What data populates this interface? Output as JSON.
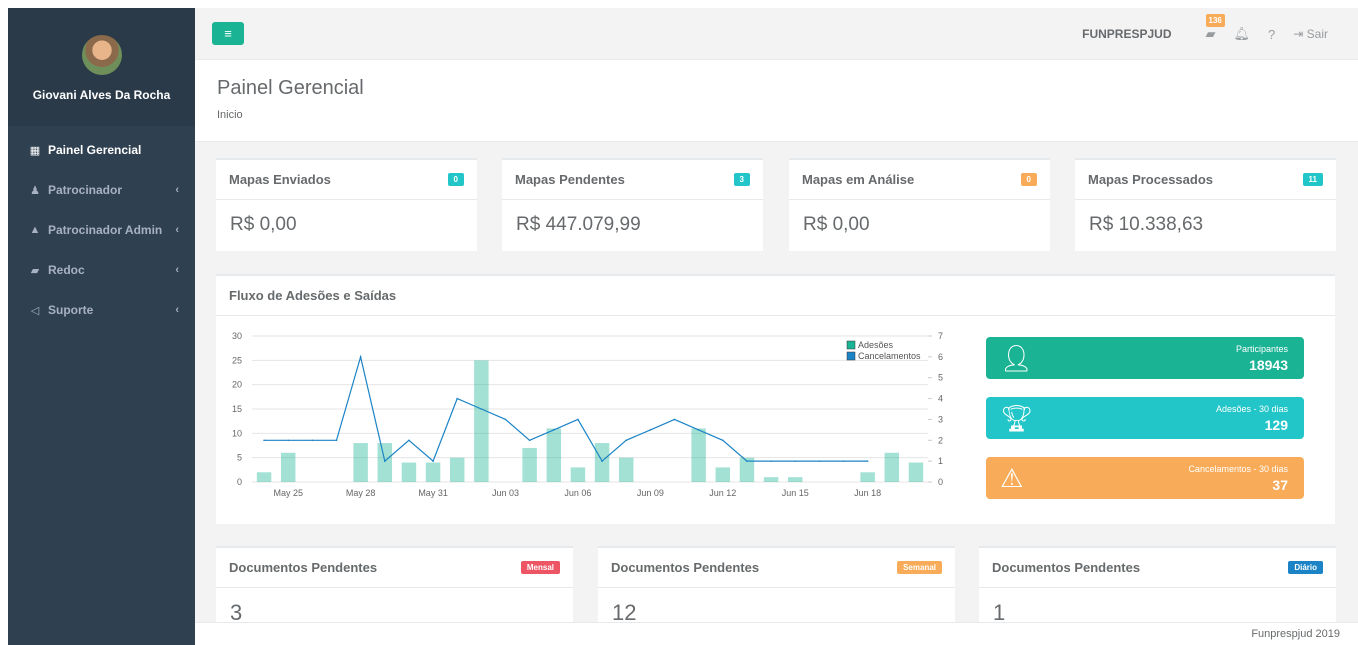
{
  "sidebar": {
    "user_name": "Giovani Alves Da Rocha",
    "items": [
      {
        "label": "Painel Gerencial",
        "icon": "th-large-icon",
        "active": true,
        "arrow": ""
      },
      {
        "label": "Patrocinador",
        "icon": "male-icon",
        "active": false,
        "arrow": "‹"
      },
      {
        "label": "Patrocinador Admin",
        "icon": "graduation-cap-icon",
        "active": false,
        "arrow": "‹"
      },
      {
        "label": "Redoc",
        "icon": "book-icon",
        "active": false,
        "arrow": "‹"
      },
      {
        "label": "Suporte",
        "icon": "bullhorn-icon",
        "active": false,
        "arrow": "‹"
      }
    ]
  },
  "topbar": {
    "org_name": "FUNPRESPJUD",
    "doc_badge": "136",
    "logout_label": "Sair"
  },
  "heading": {
    "title": "Painel Gerencial",
    "breadcrumb": "Inicio"
  },
  "stats": [
    {
      "title": "Mapas Enviados",
      "badge": "0",
      "badge_color": "#23c6c8",
      "value": "R$ 0,00"
    },
    {
      "title": "Mapas Pendentes",
      "badge": "3",
      "badge_color": "#23c6c8",
      "value": "R$ 447.079,99"
    },
    {
      "title": "Mapas em Análise",
      "badge": "0",
      "badge_color": "#f8ac59",
      "value": "R$ 0,00"
    },
    {
      "title": "Mapas Processados",
      "badge": "11",
      "badge_color": "#23c6c8",
      "value": "R$ 10.338,63"
    }
  ],
  "chart_box": {
    "title": "Fluxo de Adesões e Saídas"
  },
  "chart_data": {
    "type": "bar",
    "x_tick_labels": [
      "May 25",
      "May 28",
      "May 31",
      "Jun 03",
      "Jun 06",
      "Jun 09",
      "Jun 12",
      "Jun 15",
      "Jun 18"
    ],
    "series": [
      {
        "name": "Adesões",
        "type": "bar",
        "axis": "left",
        "color": "#1ab394",
        "values": [
          2,
          6,
          0,
          0,
          8,
          8,
          4,
          4,
          5,
          25,
          0,
          7,
          11,
          3,
          8,
          5,
          0,
          0,
          11,
          3,
          5,
          1,
          1,
          0,
          0,
          2,
          6,
          4
        ]
      },
      {
        "name": "Cancelamentos",
        "type": "line",
        "axis": "right",
        "color": "#1c84c6",
        "values": [
          2,
          2,
          2,
          2,
          6,
          1,
          2,
          1,
          4,
          3.5,
          3,
          2,
          2.5,
          3,
          1,
          2,
          2.5,
          3,
          2.5,
          2,
          1,
          1,
          1,
          1,
          1,
          1,
          null,
          null
        ]
      }
    ],
    "y_left": {
      "min": 0,
      "max": 30,
      "ticks": [
        0,
        5,
        10,
        15,
        20,
        25,
        30
      ]
    },
    "y_right": {
      "min": 0,
      "max": 7,
      "ticks": [
        0,
        1,
        2,
        3,
        4,
        5,
        6,
        7
      ]
    },
    "legend_position": "top-right",
    "grid": true
  },
  "widgets": [
    {
      "label": "Participantes",
      "value": "18943",
      "color": "#1ab394",
      "icon": "user-icon"
    },
    {
      "label": "Adesões - 30 dias",
      "value": "129",
      "color": "#23c6c8",
      "icon": "trophy-icon"
    },
    {
      "label": "Cancelamentos - 30 dias",
      "value": "37",
      "color": "#f8ac59",
      "icon": "warning-icon"
    }
  ],
  "docs": [
    {
      "title": "Documentos Pendentes",
      "badge": "Mensal",
      "badge_color": "#ed5565",
      "value": "3"
    },
    {
      "title": "Documentos Pendentes",
      "badge": "Semanal",
      "badge_color": "#f8ac59",
      "value": "12"
    },
    {
      "title": "Documentos Pendentes",
      "badge": "Diário",
      "badge_color": "#1c84c6",
      "value": "1"
    }
  ],
  "footer": {
    "text": "Funprespjud 2019"
  }
}
